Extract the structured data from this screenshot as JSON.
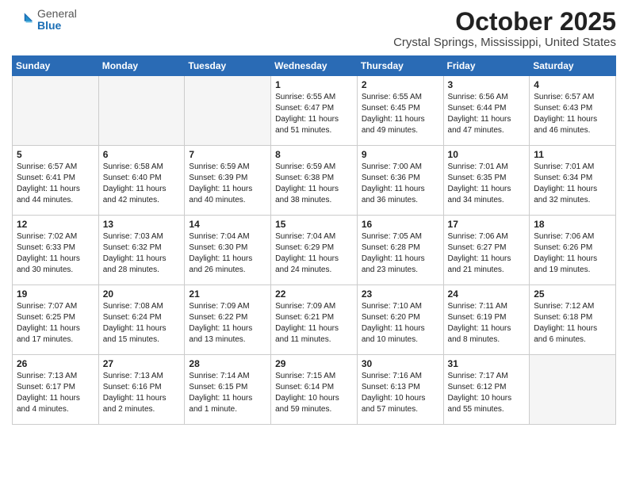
{
  "logo": {
    "general": "General",
    "blue": "Blue"
  },
  "title": {
    "month": "October 2025",
    "location": "Crystal Springs, Mississippi, United States"
  },
  "headers": [
    "Sunday",
    "Monday",
    "Tuesday",
    "Wednesday",
    "Thursday",
    "Friday",
    "Saturday"
  ],
  "weeks": [
    [
      {
        "day": "",
        "info": ""
      },
      {
        "day": "",
        "info": ""
      },
      {
        "day": "",
        "info": ""
      },
      {
        "day": "1",
        "info": "Sunrise: 6:55 AM\nSunset: 6:47 PM\nDaylight: 11 hours\nand 51 minutes."
      },
      {
        "day": "2",
        "info": "Sunrise: 6:55 AM\nSunset: 6:45 PM\nDaylight: 11 hours\nand 49 minutes."
      },
      {
        "day": "3",
        "info": "Sunrise: 6:56 AM\nSunset: 6:44 PM\nDaylight: 11 hours\nand 47 minutes."
      },
      {
        "day": "4",
        "info": "Sunrise: 6:57 AM\nSunset: 6:43 PM\nDaylight: 11 hours\nand 46 minutes."
      }
    ],
    [
      {
        "day": "5",
        "info": "Sunrise: 6:57 AM\nSunset: 6:41 PM\nDaylight: 11 hours\nand 44 minutes."
      },
      {
        "day": "6",
        "info": "Sunrise: 6:58 AM\nSunset: 6:40 PM\nDaylight: 11 hours\nand 42 minutes."
      },
      {
        "day": "7",
        "info": "Sunrise: 6:59 AM\nSunset: 6:39 PM\nDaylight: 11 hours\nand 40 minutes."
      },
      {
        "day": "8",
        "info": "Sunrise: 6:59 AM\nSunset: 6:38 PM\nDaylight: 11 hours\nand 38 minutes."
      },
      {
        "day": "9",
        "info": "Sunrise: 7:00 AM\nSunset: 6:36 PM\nDaylight: 11 hours\nand 36 minutes."
      },
      {
        "day": "10",
        "info": "Sunrise: 7:01 AM\nSunset: 6:35 PM\nDaylight: 11 hours\nand 34 minutes."
      },
      {
        "day": "11",
        "info": "Sunrise: 7:01 AM\nSunset: 6:34 PM\nDaylight: 11 hours\nand 32 minutes."
      }
    ],
    [
      {
        "day": "12",
        "info": "Sunrise: 7:02 AM\nSunset: 6:33 PM\nDaylight: 11 hours\nand 30 minutes."
      },
      {
        "day": "13",
        "info": "Sunrise: 7:03 AM\nSunset: 6:32 PM\nDaylight: 11 hours\nand 28 minutes."
      },
      {
        "day": "14",
        "info": "Sunrise: 7:04 AM\nSunset: 6:30 PM\nDaylight: 11 hours\nand 26 minutes."
      },
      {
        "day": "15",
        "info": "Sunrise: 7:04 AM\nSunset: 6:29 PM\nDaylight: 11 hours\nand 24 minutes."
      },
      {
        "day": "16",
        "info": "Sunrise: 7:05 AM\nSunset: 6:28 PM\nDaylight: 11 hours\nand 23 minutes."
      },
      {
        "day": "17",
        "info": "Sunrise: 7:06 AM\nSunset: 6:27 PM\nDaylight: 11 hours\nand 21 minutes."
      },
      {
        "day": "18",
        "info": "Sunrise: 7:06 AM\nSunset: 6:26 PM\nDaylight: 11 hours\nand 19 minutes."
      }
    ],
    [
      {
        "day": "19",
        "info": "Sunrise: 7:07 AM\nSunset: 6:25 PM\nDaylight: 11 hours\nand 17 minutes."
      },
      {
        "day": "20",
        "info": "Sunrise: 7:08 AM\nSunset: 6:24 PM\nDaylight: 11 hours\nand 15 minutes."
      },
      {
        "day": "21",
        "info": "Sunrise: 7:09 AM\nSunset: 6:22 PM\nDaylight: 11 hours\nand 13 minutes."
      },
      {
        "day": "22",
        "info": "Sunrise: 7:09 AM\nSunset: 6:21 PM\nDaylight: 11 hours\nand 11 minutes."
      },
      {
        "day": "23",
        "info": "Sunrise: 7:10 AM\nSunset: 6:20 PM\nDaylight: 11 hours\nand 10 minutes."
      },
      {
        "day": "24",
        "info": "Sunrise: 7:11 AM\nSunset: 6:19 PM\nDaylight: 11 hours\nand 8 minutes."
      },
      {
        "day": "25",
        "info": "Sunrise: 7:12 AM\nSunset: 6:18 PM\nDaylight: 11 hours\nand 6 minutes."
      }
    ],
    [
      {
        "day": "26",
        "info": "Sunrise: 7:13 AM\nSunset: 6:17 PM\nDaylight: 11 hours\nand 4 minutes."
      },
      {
        "day": "27",
        "info": "Sunrise: 7:13 AM\nSunset: 6:16 PM\nDaylight: 11 hours\nand 2 minutes."
      },
      {
        "day": "28",
        "info": "Sunrise: 7:14 AM\nSunset: 6:15 PM\nDaylight: 11 hours\nand 1 minute."
      },
      {
        "day": "29",
        "info": "Sunrise: 7:15 AM\nSunset: 6:14 PM\nDaylight: 10 hours\nand 59 minutes."
      },
      {
        "day": "30",
        "info": "Sunrise: 7:16 AM\nSunset: 6:13 PM\nDaylight: 10 hours\nand 57 minutes."
      },
      {
        "day": "31",
        "info": "Sunrise: 7:17 AM\nSunset: 6:12 PM\nDaylight: 10 hours\nand 55 minutes."
      },
      {
        "day": "",
        "info": ""
      }
    ]
  ]
}
